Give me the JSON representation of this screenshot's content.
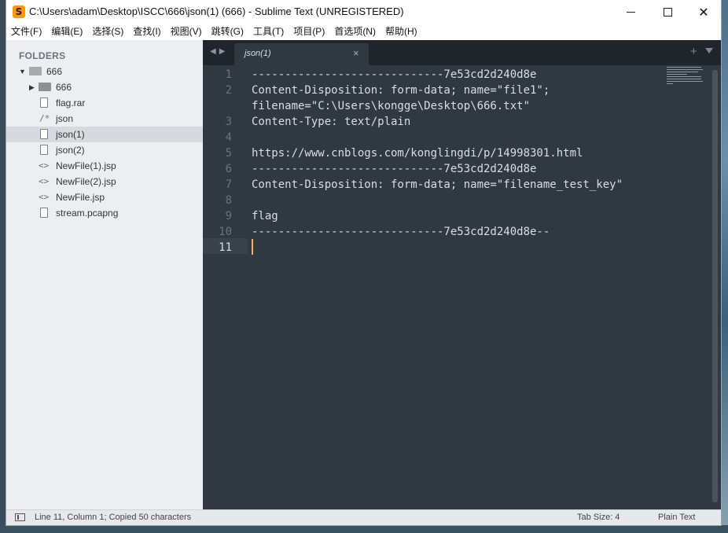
{
  "window": {
    "title": "C:\\Users\\adam\\Desktop\\ISCC\\666\\json(1) (666) - Sublime Text (UNREGISTERED)"
  },
  "menu": [
    "文件(F)",
    "编辑(E)",
    "选择(S)",
    "查找(I)",
    "视图(V)",
    "跳转(G)",
    "工具(T)",
    "项目(P)",
    "首选项(N)",
    "帮助(H)"
  ],
  "sidebar": {
    "title": "FOLDERS",
    "root": "666",
    "items": [
      {
        "label": "666",
        "type": "folder"
      },
      {
        "label": "flag.rar",
        "type": "file"
      },
      {
        "label": "json",
        "type": "comment-file"
      },
      {
        "label": "json(1)",
        "type": "file",
        "selected": true
      },
      {
        "label": "json(2)",
        "type": "file"
      },
      {
        "label": "NewFile(1).jsp",
        "type": "code-file"
      },
      {
        "label": "NewFile(2).jsp",
        "type": "code-file"
      },
      {
        "label": "NewFile.jsp",
        "type": "code-file"
      },
      {
        "label": "stream.pcapng",
        "type": "file"
      }
    ]
  },
  "editor": {
    "tab": {
      "title": "json(1)",
      "close": "×"
    },
    "lines": [
      {
        "num": "1",
        "text": "-----------------------------7e53cd2d240d8e"
      },
      {
        "num": "2",
        "text": "Content-Disposition: form-data; name=\"file1\";"
      },
      {
        "num": "",
        "text": "filename=\"C:\\Users\\kongge\\Desktop\\666.txt\""
      },
      {
        "num": "3",
        "text": "Content-Type: text/plain"
      },
      {
        "num": "4",
        "text": ""
      },
      {
        "num": "",
        "text": "https://www.cnblogs.com/konglingdi/p/14998301.html"
      },
      {
        "num": "6",
        "text": "-----------------------------7e53cd2d240d8e"
      },
      {
        "num": "7",
        "text": "Content-Disposition: form-data; name=\"filename_test_key\""
      },
      {
        "num": "8",
        "text": ""
      },
      {
        "num": "9",
        "text": "flag"
      },
      {
        "num": "10",
        "text": "-----------------------------7e53cd2d240d8e--"
      },
      {
        "num": "11",
        "text": "",
        "active": true
      }
    ]
  },
  "status": {
    "position": "Line 11, Column 1; Copied 50 characters",
    "tab_size": "Tab Size: 4",
    "syntax": "Plain Text"
  },
  "colors": {
    "editor_bg": "#303841",
    "text": "#d8dee9",
    "cursor": "#f9ae58",
    "tabbar_bg": "#1f252b"
  }
}
